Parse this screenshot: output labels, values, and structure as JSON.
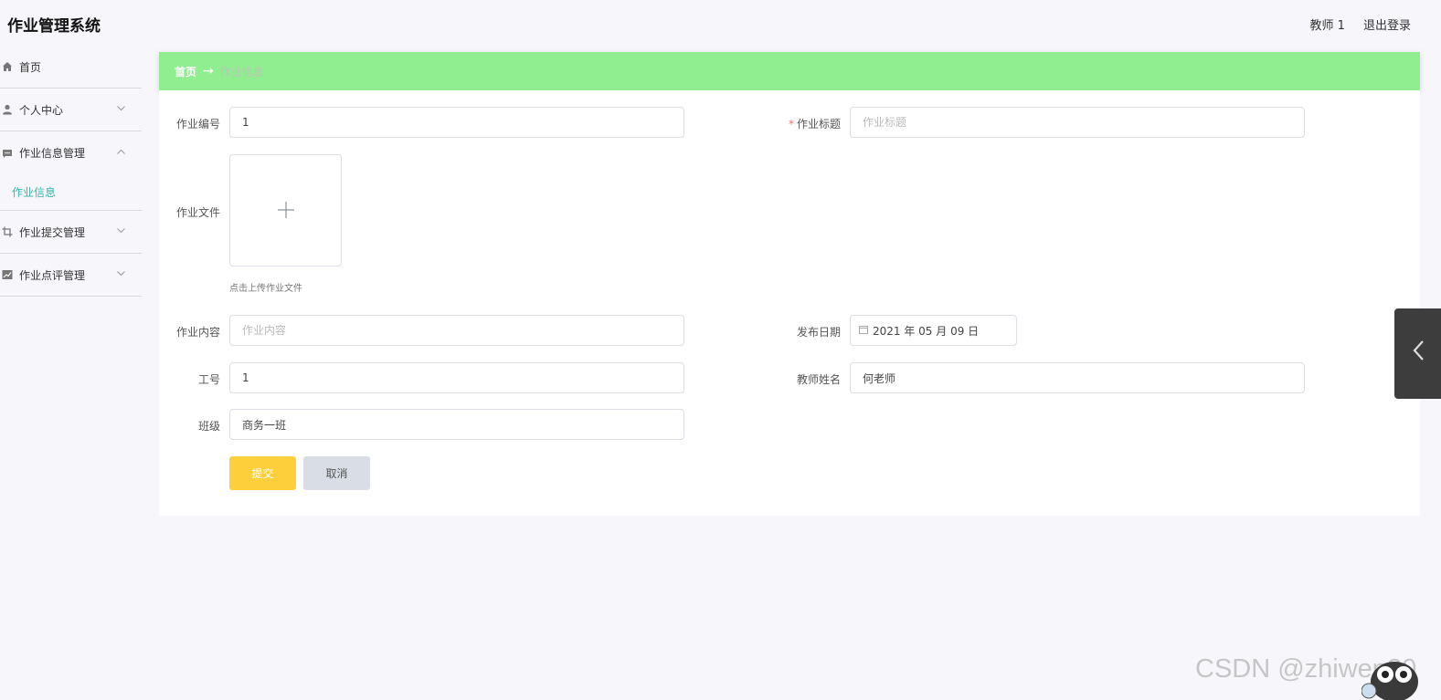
{
  "app": {
    "title": "作业管理系统"
  },
  "header": {
    "username": "教师 1",
    "logout_label": "退出登录"
  },
  "sidebar": {
    "items": [
      {
        "label": "首页",
        "icon": "home-icon"
      },
      {
        "label": "个人中心",
        "icon": "user-icon",
        "expanded": false
      },
      {
        "label": "作业信息管理",
        "icon": "message-icon",
        "expanded": true,
        "children": [
          {
            "label": "作业信息",
            "active": true
          }
        ]
      },
      {
        "label": "作业提交管理",
        "icon": "crop-icon",
        "expanded": false
      },
      {
        "label": "作业点评管理",
        "icon": "chart-icon",
        "expanded": false
      }
    ]
  },
  "breadcrumb": {
    "home": "首页",
    "separator": "→",
    "current": "作业信息"
  },
  "form": {
    "homework_no": {
      "label": "作业编号",
      "value": "1"
    },
    "homework_title": {
      "label": "作业标题",
      "placeholder": "作业标题",
      "value": "",
      "required": true
    },
    "homework_file": {
      "label": "作业文件",
      "hint": "点击上传作业文件"
    },
    "homework_content": {
      "label": "作业内容",
      "placeholder": "作业内容",
      "value": ""
    },
    "publish_date": {
      "label": "发布日期",
      "value": "2021 年 05 月 09 日"
    },
    "staff_no": {
      "label": "工号",
      "value": "1"
    },
    "teacher_name": {
      "label": "教师姓名",
      "value": "何老师"
    },
    "class": {
      "label": "班级",
      "value": "商务一班"
    },
    "submit_label": "提交",
    "cancel_label": "取消"
  },
  "watermark": "CSDN @zhiwen20",
  "colors": {
    "breadcrumb_bg": "#90ee90",
    "submit_bg": "#fdd03b",
    "active_menu": "#35b7a8",
    "required": "#f56c6c"
  }
}
